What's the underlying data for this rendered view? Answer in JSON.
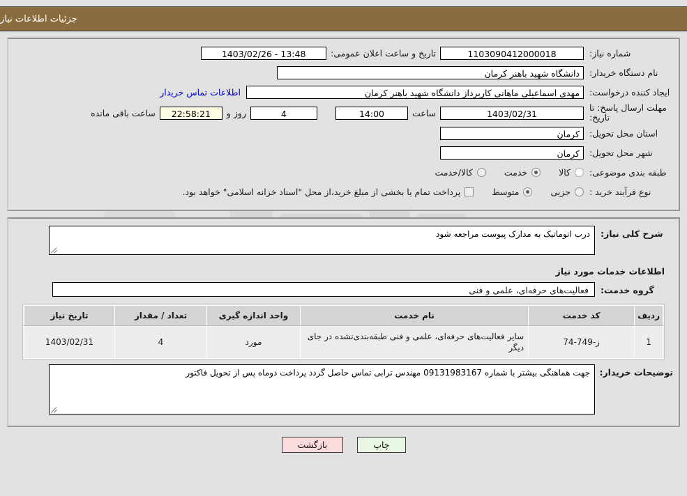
{
  "header": {
    "title": "جزئیات اطلاعات نیاز"
  },
  "top_form": {
    "need_number": {
      "label": "شماره نیاز:",
      "value": "1103090412000018"
    },
    "announce": {
      "label": "تاریخ و ساعت اعلان عمومی:",
      "value": "13:48 - 1403/02/26"
    },
    "buyer_org": {
      "label": "نام دستگاه خریدار:",
      "value": "دانشگاه شهید باهنر کرمان"
    },
    "creator": {
      "label": "ایجاد کننده درخواست:",
      "value": "مهدی اسماعیلی ماهانی  کاربرداز دانشگاه شهید باهنر کرمان"
    },
    "contact_link": "اطلاعات تماس خریدار",
    "deadline": {
      "label_line1": "مهلت ارسال پاسخ: تا",
      "label_line2": "تاریخ:",
      "date": "1403/02/31",
      "hour_label": "ساعت",
      "hour": "14:00",
      "days": "4",
      "days_label": "روز و",
      "timer": "22:58:21",
      "timer_label": "ساعت باقی مانده"
    },
    "province": {
      "label": "استان محل تحویل:",
      "value": "کرمان"
    },
    "city": {
      "label": "شهر محل تحویل:",
      "value": "کرمان"
    },
    "category": {
      "label": "طبقه بندی موضوعی:",
      "options": [
        {
          "label": "کالا",
          "checked": false,
          "hover": true
        },
        {
          "label": "خدمت",
          "checked": true,
          "hover": false
        },
        {
          "label": "کالا/خدمت",
          "checked": false,
          "hover": false
        }
      ]
    },
    "process_type": {
      "label": "نوع فرآیند خرید :",
      "options": [
        {
          "label": "جزیی",
          "checked": false,
          "hover": false
        },
        {
          "label": "متوسط",
          "checked": true,
          "hover": false
        }
      ],
      "treasury_checkbox_label": "پرداخت تمام یا بخشی از مبلغ خرید،از محل \"اسناد خزانه اسلامی\" خواهد بود.",
      "treasury_checked": false
    }
  },
  "bottom": {
    "need_desc": {
      "label": "شرح کلی نیاز:",
      "value": "درب اتوماتیک به مدارک پیوست مراجعه شود"
    },
    "section_title": "اطلاعات خدمات مورد نیاز",
    "service_group": {
      "label": "گروه خدمت:",
      "value": "فعالیت‌های حرفه‌ای، علمی و فنی"
    },
    "table": {
      "columns": [
        "ردیف",
        "کد خدمت",
        "نام خدمت",
        "واحد اندازه گیری",
        "تعداد / مقدار",
        "تاریخ نیاز"
      ],
      "rows": [
        {
          "radif": "1",
          "code": "ز-749-74",
          "name": "سایر فعالیت‌های حرفه‌ای، علمی و فنی طبقه‌بندی‌نشده در جای دیگر",
          "unit": "مورد",
          "qty": "4",
          "date": "1403/02/31"
        }
      ]
    },
    "buyer_notes": {
      "label": "توضیحات خریدار:",
      "value": "جهت هماهنگی بیشتر با شماره 09131983167 مهندس ترابی تماس حاصل گردد پرداخت دوماه پس از تحویل فاکتور"
    }
  },
  "buttons": {
    "print": "چاپ",
    "back": "بازگشت"
  },
  "colors": {
    "header_bar": "#8b6c3f",
    "page_bg": "#e2e2e2",
    "link": "#0000cc",
    "timer_bg": "#ffffe6",
    "print_btn": "#e7f7e4",
    "back_btn": "#fadcdc"
  }
}
